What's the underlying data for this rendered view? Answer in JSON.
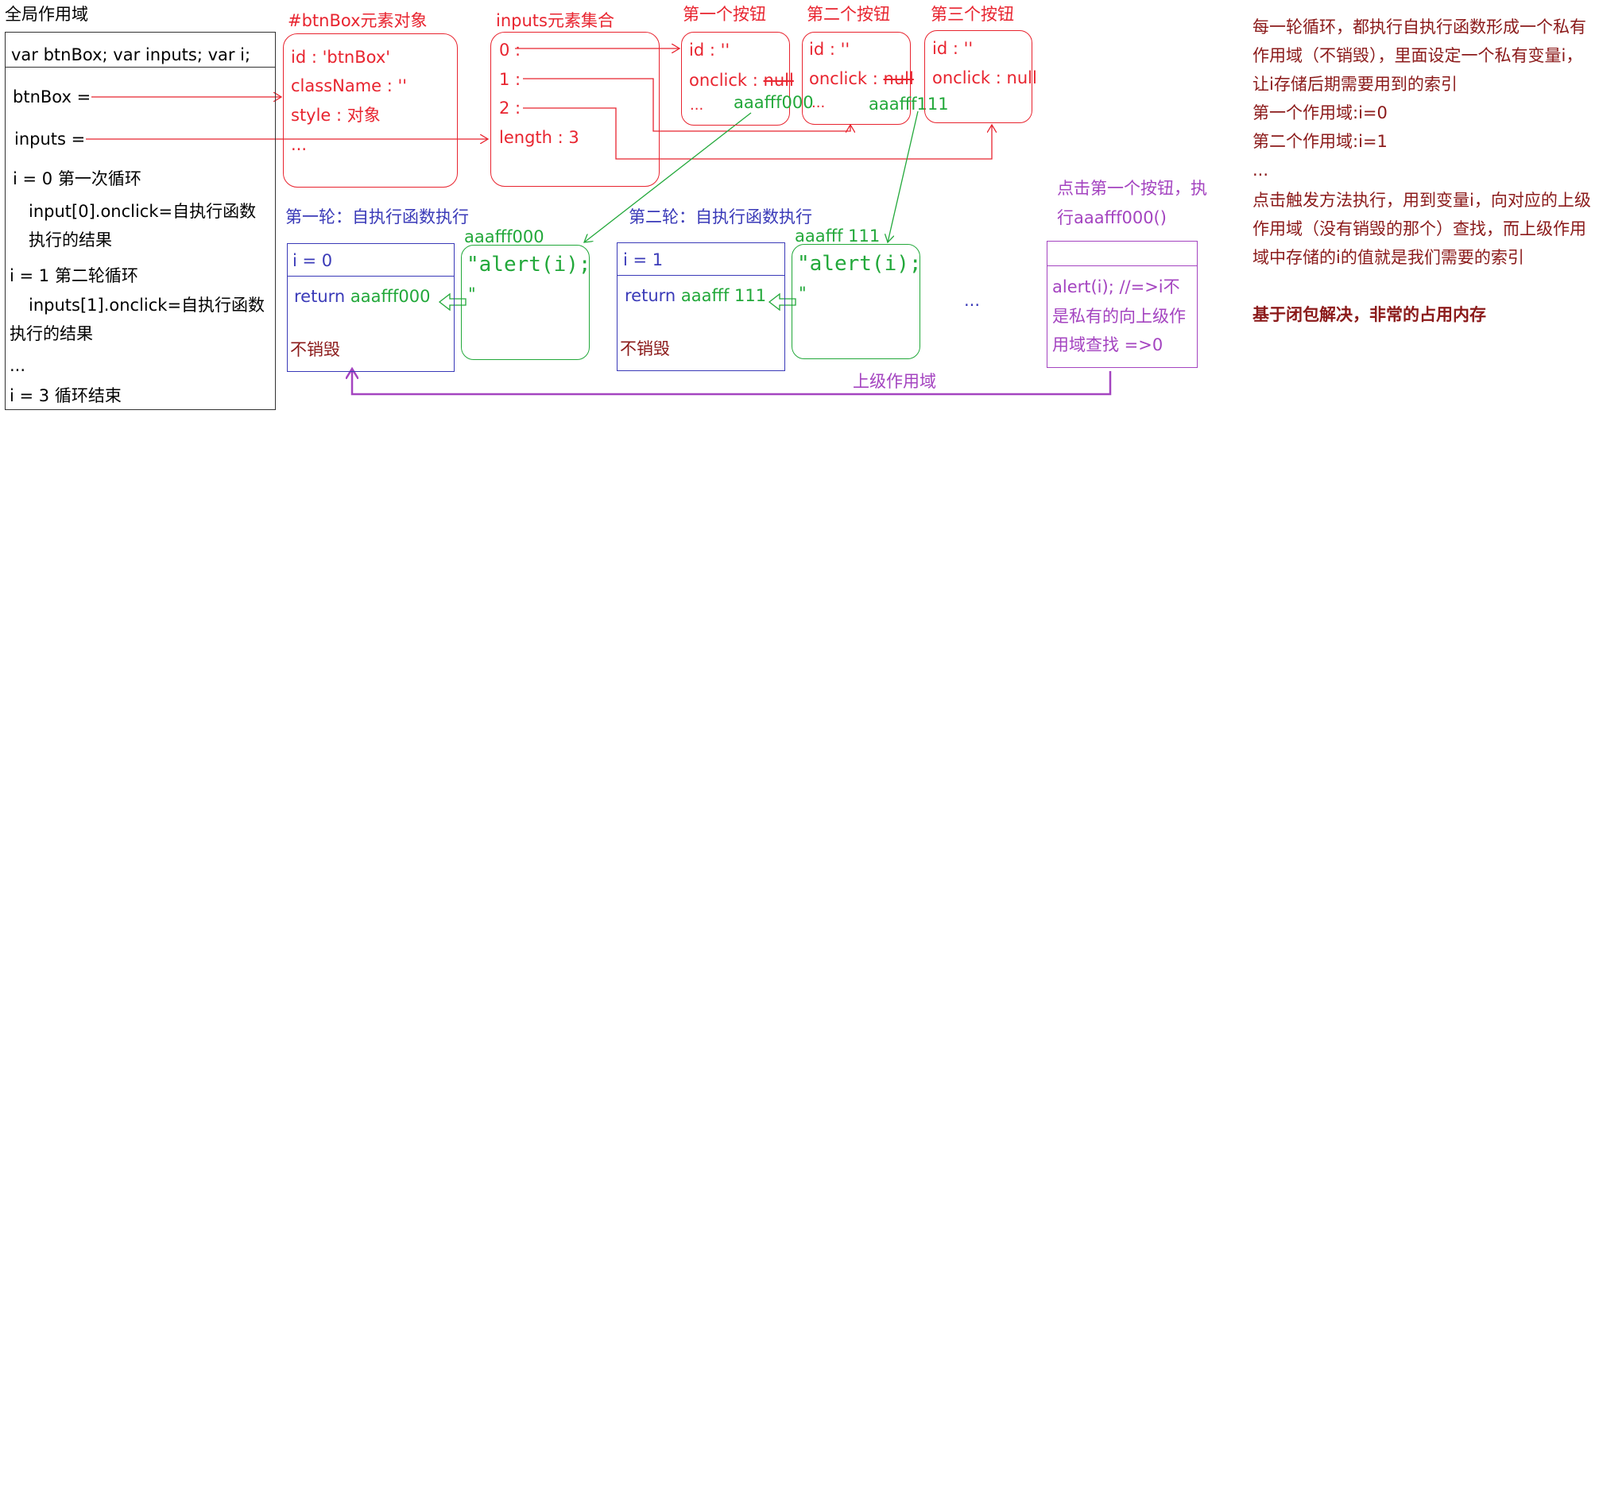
{
  "global": {
    "title": "全局作用域",
    "decl": "var btnBox;  var inputs;  var i;",
    "btnbox": "btnBox =",
    "inputs": "inputs =",
    "loop0": "i = 0  第一次循环",
    "loop0_a": "input[0].onclick=自执行函数",
    "loop0_b": "执行的结果",
    "loop1": "i = 1 第二轮循环",
    "loop1_a": "inputs[1].onclick=自执行函数",
    "loop1_b": "执行的结果",
    "ellipsis": "...",
    "end": "i = 3   循环结束"
  },
  "btnbox_obj": {
    "title": "#btnBox元素对象",
    "id": "id : 'btnBox'",
    "classname": "className : ''",
    "style": "style : 对象",
    "ellipsis": "..."
  },
  "inputs_coll": {
    "title": "inputs元素集合",
    "item0": "0 :",
    "item1": "1 :",
    "item2": "2 :",
    "length": "length : 3"
  },
  "buttons": [
    {
      "title": "第一个按钮",
      "id": "id : ''",
      "onclick": "onclick : ",
      "onclick_val": "null",
      "ellipsis": "...",
      "ref": "aaafff000"
    },
    {
      "title": "第二个按钮",
      "id": "id : ''",
      "onclick": "onclick : ",
      "onclick_val": "null",
      "ellipsis": "...",
      "ref": "aaafff111"
    },
    {
      "title": "第三个按钮",
      "id": "id : ''",
      "onclick": "onclick : ",
      "onclick_val": "null"
    }
  ],
  "round1": {
    "title": "第一轮：自执行函数执行",
    "var": "i = 0",
    "return_kw": "return",
    "return_ref": "aaafff000",
    "keep": "不销毁",
    "fn_label": "aaafff000",
    "fn_code": "\"alert(i);",
    "fn_close": "\""
  },
  "round2": {
    "title": "第二轮：自执行函数执行",
    "var": "i = 1",
    "return_kw": "return",
    "return_ref": "aaafff 111",
    "keep": "不销毁",
    "fn_label": "aaafff 111",
    "fn_code": "\"alert(i);",
    "fn_close": "\""
  },
  "more": "...",
  "click": {
    "title_line1": "点击第一个按钮，执",
    "title_line2": "行aaafff000()",
    "body_line1": "alert(i); //=>i不",
    "body_line2": "是私有的向上级作",
    "body_line3": "用域查找    =>0"
  },
  "parent_scope": "上级作用域",
  "notes": {
    "lines": [
      "每一轮循环，都执行自执行函数形成一个私有",
      "作用域（不销毁），里面设定一个私有变量i，",
      "让i存储后期需要用到的索引",
      "第一个作用域:i=0",
      "第二个作用域:i=1",
      "...",
      "点击触发方法执行，用到变量i，向对应的上级",
      "作用域（没有销毁的那个）查找，而上级作用",
      "域中存储的i的值就是我们需要的索引"
    ],
    "conclusion": "基于闭包解决，非常的占用内存"
  },
  "colors": {
    "red": "#e8242f",
    "green": "#22a83a",
    "blue": "#3a3ab8",
    "dark_red": "#8b1a1a",
    "purple": "#a444c0"
  }
}
